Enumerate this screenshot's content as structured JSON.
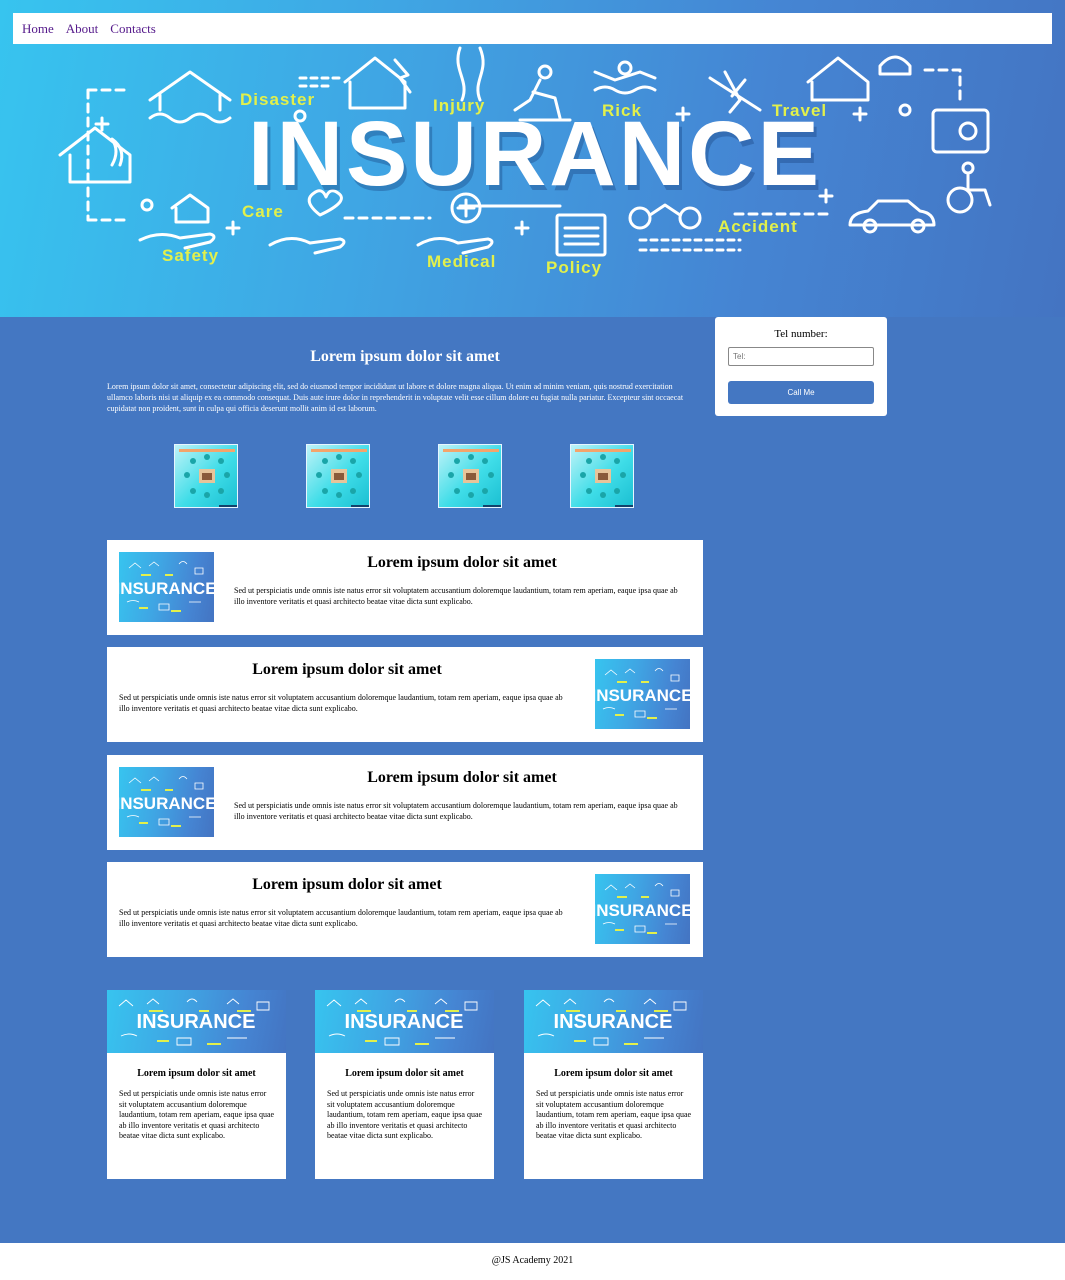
{
  "nav": {
    "items": [
      "Home",
      "About",
      "Contacts"
    ]
  },
  "hero": {
    "word": "INSURANCE",
    "tags": [
      "Disaster",
      "Injury",
      "Rick",
      "Travel",
      "Care",
      "Accident",
      "Safety",
      "Medical",
      "Policy"
    ]
  },
  "callbox": {
    "label": "Tel number:",
    "placeholder": "Tel:",
    "button": "Call Me"
  },
  "intro": {
    "title": "Lorem ipsum dolor sit amet",
    "text": "Lorem ipsum dolor sit amet, consectetur adipiscing elit, sed do eiusmod tempor incididunt ut labore et dolore magna aliqua. Ut enim ad minim veniam, quis nostrud exercitation ullamco laboris nisi ut aliquip ex ea commodo consequat. Duis aute irure dolor in reprehenderit in voluptate velit esse cillum dolore eu fugiat nulla pariatur. Excepteur sint occaecat cupidatat non proident, sunt in culpa qui officia deserunt mollit anim id est laborum."
  },
  "row_cards": [
    {
      "title": "Lorem ipsum dolor sit amet",
      "text": "Sed ut perspiciatis unde omnis iste natus error sit voluptatem accusantium doloremque laudantium, totam rem aperiam, eaque ipsa quae ab illo inventore veritatis et quasi architecto beatae vitae dicta sunt explicabo."
    },
    {
      "title": "Lorem ipsum dolor sit amet",
      "text": "Sed ut perspiciatis unde omnis iste natus error sit voluptatem accusantium doloremque laudantium, totam rem aperiam, eaque ipsa quae ab illo inventore veritatis et quasi architecto beatae vitae dicta sunt explicabo."
    },
    {
      "title": "Lorem ipsum dolor sit amet",
      "text": "Sed ut perspiciatis unde omnis iste natus error sit voluptatem accusantium doloremque laudantium, totam rem aperiam, eaque ipsa quae ab illo inventore veritatis et quasi architecto beatae vitae dicta sunt explicabo."
    },
    {
      "title": "Lorem ipsum dolor sit amet",
      "text": "Sed ut perspiciatis unde omnis iste natus error sit voluptatem accusantium doloremque laudantium, totam rem aperiam, eaque ipsa quae ab illo inventore veritatis et quasi architecto beatae vitae dicta sunt explicabo."
    }
  ],
  "col_cards": [
    {
      "title": "Lorem ipsum dolor sit amet",
      "text": "Sed ut perspiciatis unde omnis iste natus error sit voluptatem accusantium doloremque laudantium, totam rem aperiam, eaque ipsa quae ab illo inventore veritatis et quasi architecto beatae vitae dicta sunt explicabo."
    },
    {
      "title": "Lorem ipsum dolor sit amet",
      "text": "Sed ut perspiciatis unde omnis iste natus error sit voluptatem accusantium doloremque laudantium, totam rem aperiam, eaque ipsa quae ab illo inventore veritatis et quasi architecto beatae vitae dicta sunt explicabo."
    },
    {
      "title": "Lorem ipsum dolor sit amet",
      "text": "Sed ut perspiciatis unde omnis iste natus error sit voluptatem accusantium doloremque laudantium, totam rem aperiam, eaque ipsa quae ab illo inventore veritatis et quasi architecto beatae vitae dicta sunt explicabo."
    }
  ],
  "footer": {
    "text": "@JS Academy 2021"
  },
  "colors": {
    "page_bg": "#4477c2",
    "tag_yellow": "#e2f04b",
    "hero_light": "#37c4ef",
    "thumb_cyan": "#3fdde8"
  }
}
